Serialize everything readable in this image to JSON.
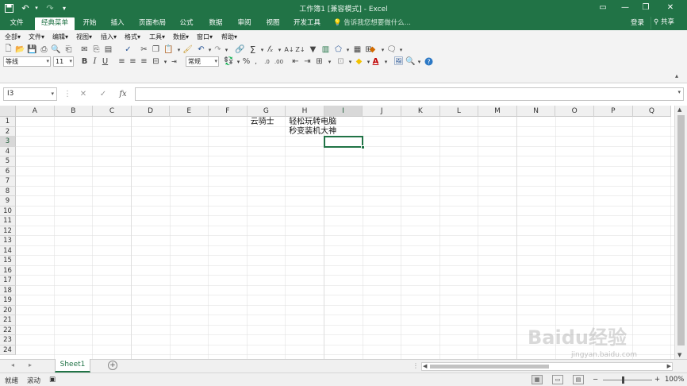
{
  "window": {
    "title": "工作簿1 [兼容模式] - Excel",
    "quick_access": [
      "save-icon",
      "undo-icon",
      "redo-icon",
      "customize-icon"
    ]
  },
  "ribbon_tabs": [
    {
      "label": "文件",
      "active": false
    },
    {
      "label": "经典菜单",
      "active": true
    },
    {
      "label": "开始",
      "active": false
    },
    {
      "label": "插入",
      "active": false
    },
    {
      "label": "页面布局",
      "active": false
    },
    {
      "label": "公式",
      "active": false
    },
    {
      "label": "数据",
      "active": false
    },
    {
      "label": "审阅",
      "active": false
    },
    {
      "label": "视图",
      "active": false
    },
    {
      "label": "开发工具",
      "active": false
    }
  ],
  "tell_me": "告诉我您想要做什么...",
  "account": {
    "login": "登录",
    "share": "共享"
  },
  "classic_menu": [
    "全部▾",
    "文件▾",
    "编辑▾",
    "视图▾",
    "插入▾",
    "格式▾",
    "工具▾",
    "数据▾",
    "窗口▾",
    "帮助▾"
  ],
  "font": {
    "name": "等线",
    "size": "11"
  },
  "number_format": "常规",
  "formula_bar": {
    "name_box": "I3",
    "cancel": "✕",
    "enter": "✓",
    "fx": "fx",
    "value": ""
  },
  "columns": [
    "A",
    "B",
    "C",
    "D",
    "E",
    "F",
    "G",
    "H",
    "I",
    "J",
    "K",
    "L",
    "M",
    "N",
    "O",
    "P",
    "Q"
  ],
  "rows": [
    "1",
    "2",
    "3",
    "4",
    "5",
    "6",
    "7",
    "8",
    "9",
    "10",
    "11",
    "12",
    "13",
    "14",
    "15",
    "16",
    "17",
    "18",
    "19",
    "20",
    "21",
    "22",
    "23",
    "24"
  ],
  "cells": {
    "G1": "云骑士",
    "H1": "轻松玩转电脑",
    "H2": "秒变装机大神"
  },
  "active_cell": "I3",
  "sheets": [
    {
      "name": "Sheet1",
      "active": true
    }
  ],
  "status": {
    "mode": "就绪",
    "scroll": "滚动",
    "zoom": "100%"
  },
  "watermark": {
    "text": "Baidu经验",
    "sub": "jingyan.baidu.com"
  }
}
